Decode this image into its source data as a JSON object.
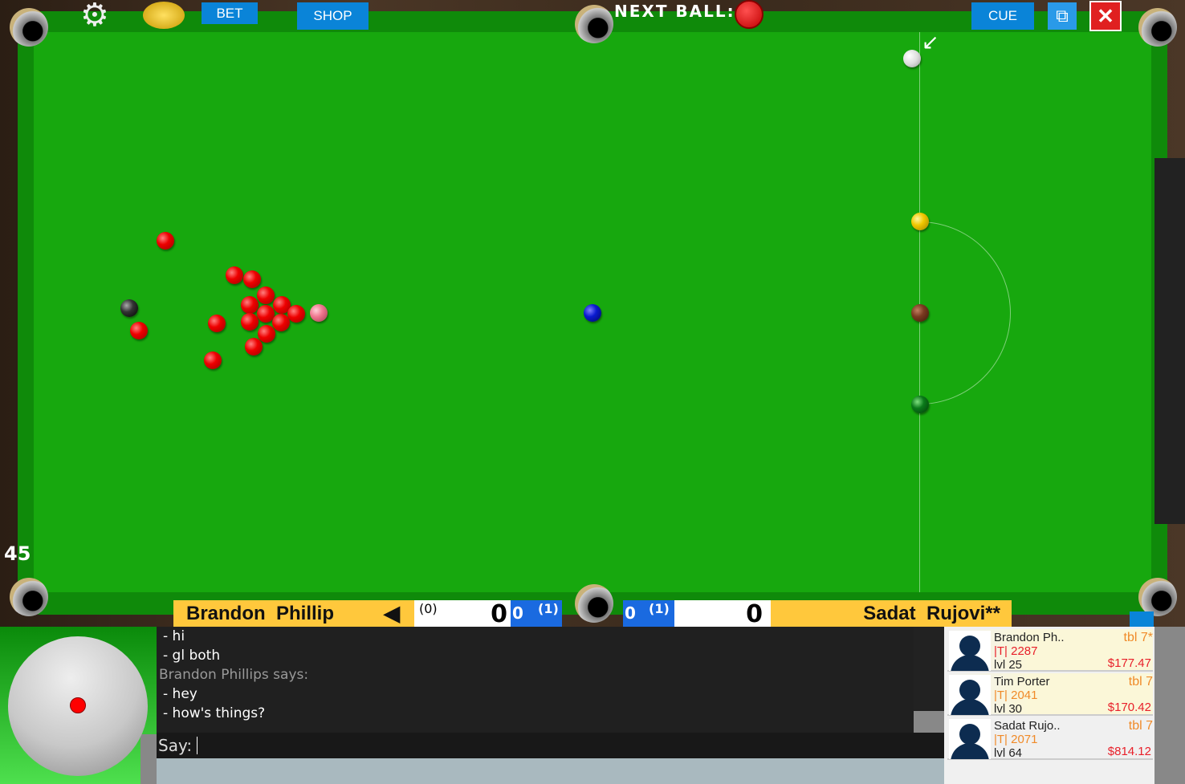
{
  "toolbar": {
    "bet_label": "BET",
    "shop_label": "SHOP",
    "cue_label": "CUE",
    "next_ball_label": "NEXT BALL:",
    "next_ball_color": "#e00000",
    "settings_icon": "gear-icon",
    "coins_icon": "coins-icon",
    "popout_icon": "external-window-icon",
    "close_icon": "close-icon"
  },
  "timer": "45",
  "scoreboard": {
    "player1": {
      "name": "Brandon  Phillip",
      "frames_paren": "(0)",
      "score": "0",
      "frames": "0",
      "frames_total": "(1)"
    },
    "player2": {
      "name": "Sadat  Rujovi**",
      "frames_paren": "(1)",
      "score": "0",
      "frames": "0"
    },
    "turn_indicator": "◀"
  },
  "chat": {
    "lines": [
      "- hi",
      "- gl both",
      "Brandon Phillips says:",
      "- hey",
      "- how's things?"
    ],
    "say_label": "Say:",
    "input_value": ""
  },
  "players": [
    {
      "name": "Brandon Ph..",
      "rating": "|T| 2287",
      "level": "lvl 25",
      "table": "tbl 7*",
      "money": "$177.47",
      "rating_color": "#e8202a"
    },
    {
      "name": "Tim Porter",
      "rating": "|T| 2041",
      "level": "lvl 30",
      "table": "tbl 7",
      "money": "$170.42",
      "rating_color": "#f08a28"
    },
    {
      "name": "Sadat Rujo..",
      "rating": "|T| 2071",
      "level": "lvl 64",
      "table": "tbl 7",
      "money": "$814.12",
      "rating_color": "#f08a28"
    }
  ],
  "colors": {
    "felt": "#17a80e",
    "accent": "#0a84d8",
    "name_bar": "#ffc83c"
  }
}
